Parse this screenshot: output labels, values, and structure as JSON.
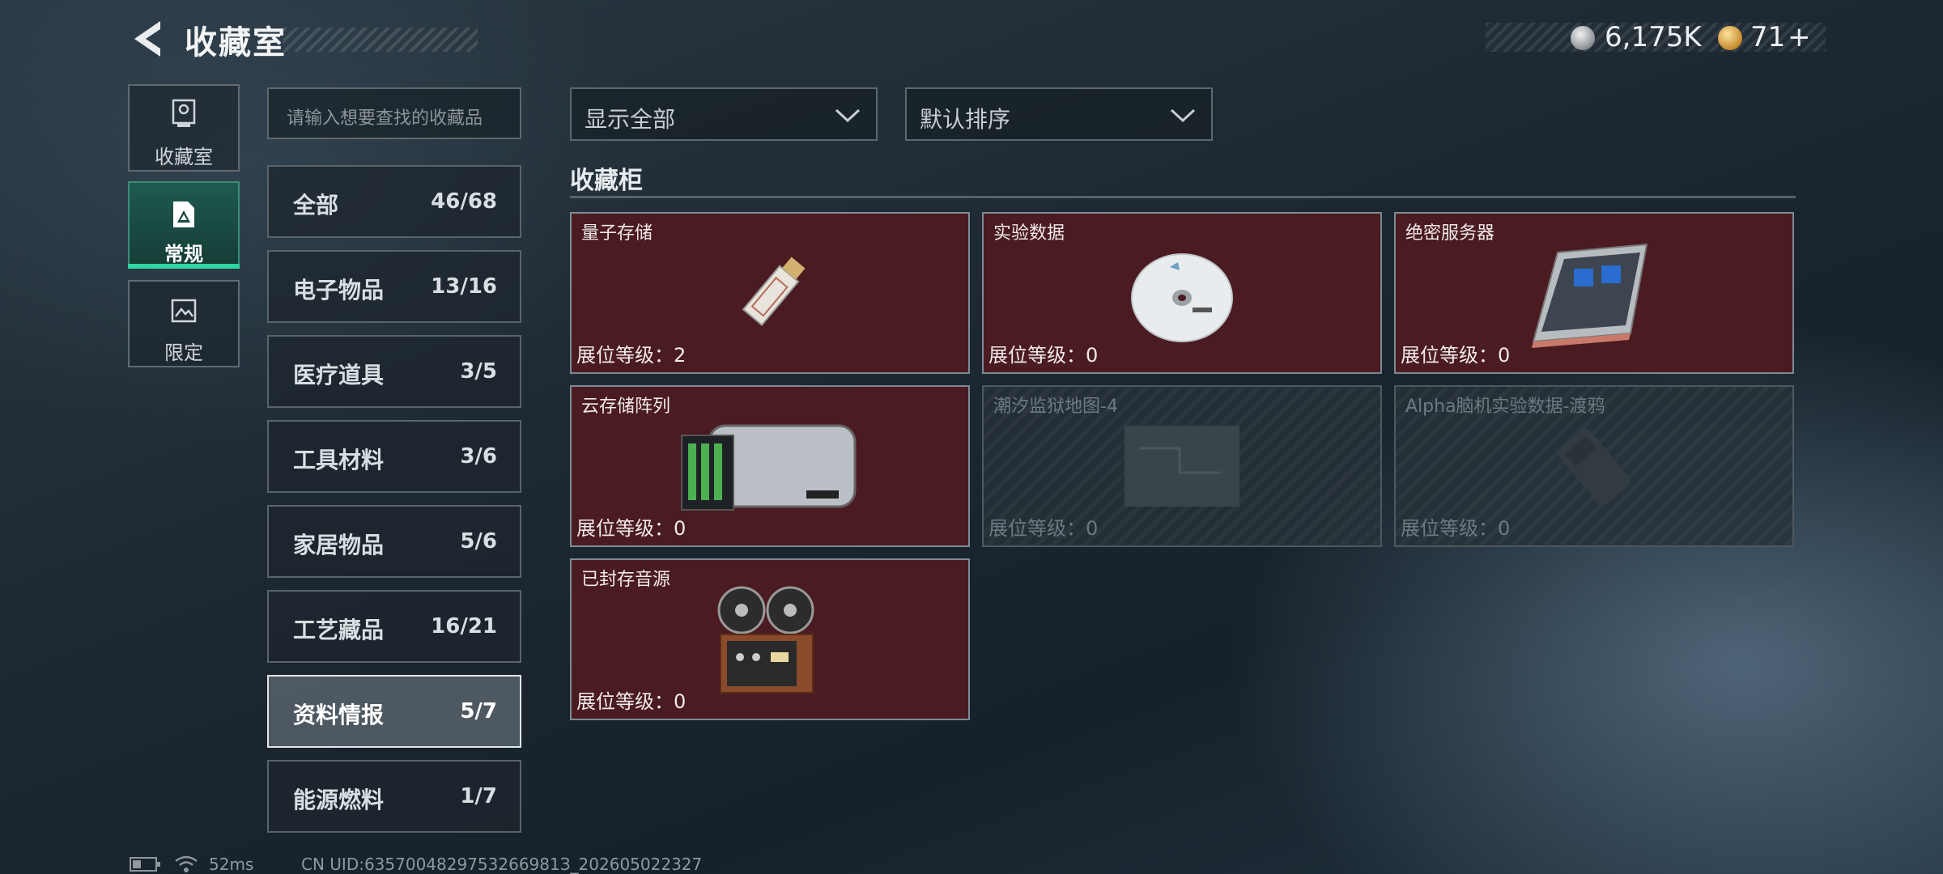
{
  "header": {
    "title": "收藏室",
    "currency": [
      {
        "name": "silver",
        "value": "6,175K",
        "icon": "silver-coin-icon"
      },
      {
        "name": "gold",
        "value": "71",
        "icon": "gold-coin-icon",
        "add_symbol": "+"
      }
    ]
  },
  "tabs": [
    {
      "label": "收藏室",
      "icon": "trophy-icon"
    },
    {
      "label": "常规",
      "icon": "document-icon",
      "active": true
    },
    {
      "label": "限定",
      "icon": "image-icon"
    }
  ],
  "search": {
    "placeholder": "请输入想要查找的收藏品"
  },
  "categories": [
    {
      "name": "全部",
      "count": "46/68"
    },
    {
      "name": "电子物品",
      "count": "13/16"
    },
    {
      "name": "医疗道具",
      "count": "3/5"
    },
    {
      "name": "工具材料",
      "count": "3/6"
    },
    {
      "name": "家居物品",
      "count": "5/6"
    },
    {
      "name": "工艺藏品",
      "count": "16/21"
    },
    {
      "name": "资料情报",
      "count": "5/7",
      "selected": true
    },
    {
      "name": "能源燃料",
      "count": "1/7"
    }
  ],
  "filters": {
    "display": "显示全部",
    "sort": "默认排序"
  },
  "section": {
    "title": "收藏柜"
  },
  "items": [
    {
      "name": "量子存储",
      "level": "展位等级：2",
      "unlocked": true,
      "icon": "usb-drive-icon"
    },
    {
      "name": "实验数据",
      "level": "展位等级：0",
      "unlocked": true,
      "icon": "disc-icon"
    },
    {
      "name": "绝密服务器",
      "level": "展位等级：0",
      "unlocked": true,
      "icon": "server-icon"
    },
    {
      "name": "云存储阵列",
      "level": "展位等级：0",
      "unlocked": true,
      "icon": "storage-array-icon"
    },
    {
      "name": "潮汐监狱地图-4",
      "level": "展位等级：0",
      "unlocked": false,
      "icon": "map-icon"
    },
    {
      "name": "Alpha脑机实验数据-渡鸦",
      "level": "展位等级：0",
      "unlocked": false,
      "icon": "device-icon"
    },
    {
      "name": "已封存音源",
      "level": "展位等级：0",
      "unlocked": true,
      "icon": "reel-recorder-icon"
    }
  ],
  "status_bar": {
    "ping": "52ms",
    "uid": "CN UID:6357004829753266981З_202605022327"
  },
  "colors": {
    "accent": "#2fd6a2",
    "card_unlocked": "#4a1b20",
    "card_locked": "#263037"
  }
}
